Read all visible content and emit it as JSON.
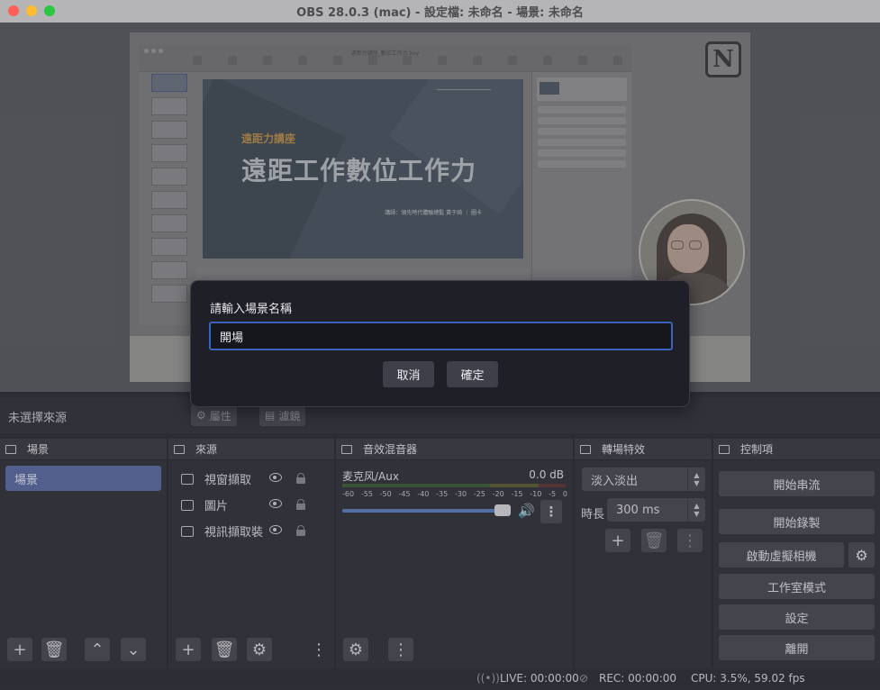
{
  "window": {
    "title": "OBS 28.0.3 (mac) - 設定檔: 未命名 - 場景: 未命名"
  },
  "preview": {
    "keynote_filename": "遠距力講座_數位工作力.key",
    "slide_subtitle": "遠距力講座",
    "slide_headline": "遠距工作數位工作力",
    "slide_credit": "講師：領先時代體驗總監 黃于綺 ｜ 圖卡",
    "notion_logo": "N"
  },
  "source_bar": {
    "no_source_label": "未選擇來源",
    "properties_label": "屬性",
    "filters_label": "濾鏡"
  },
  "docks": {
    "scenes": {
      "title": "場景",
      "items": [
        "場景"
      ]
    },
    "sources": {
      "title": "來源",
      "items": [
        {
          "label": "視窗擷取",
          "icon": "window-icon"
        },
        {
          "label": "圖片",
          "icon": "image-icon"
        },
        {
          "label": "視訊擷取裝",
          "icon": "camera-icon"
        }
      ]
    },
    "mixer": {
      "title": "音效混音器",
      "channel_name": "麦克风/Aux",
      "channel_db": "0.0 dB",
      "ticks": [
        "-60",
        "-55",
        "-50",
        "-45",
        "-40",
        "-35",
        "-30",
        "-25",
        "-20",
        "-15",
        "-10",
        "-5",
        "0"
      ],
      "volume_level": 0.97
    },
    "transitions": {
      "title": "轉場特效",
      "selected": "淡入淡出",
      "duration_label": "時長",
      "duration_value": "300 ms"
    },
    "controls": {
      "title": "控制項",
      "start_streaming": "開始串流",
      "start_recording": "開始錄製",
      "start_virtual_camera": "啟動虛擬相機",
      "studio_mode": "工作室模式",
      "settings": "設定",
      "exit": "離開"
    }
  },
  "status_bar": {
    "live": "LIVE: 00:00:00",
    "rec": "REC: 00:00:00",
    "cpu": "CPU: 3.5%, 59.02 fps"
  },
  "dialog": {
    "prompt": "請輸入場景名稱",
    "input_value": "開場",
    "cancel_label": "取消",
    "ok_label": "確定"
  },
  "colors": {
    "accent": "#3c63b9",
    "selected_scene": "#5c6ca3",
    "dialog_bg": "#1f2027",
    "panel_bg": "#33343c"
  }
}
